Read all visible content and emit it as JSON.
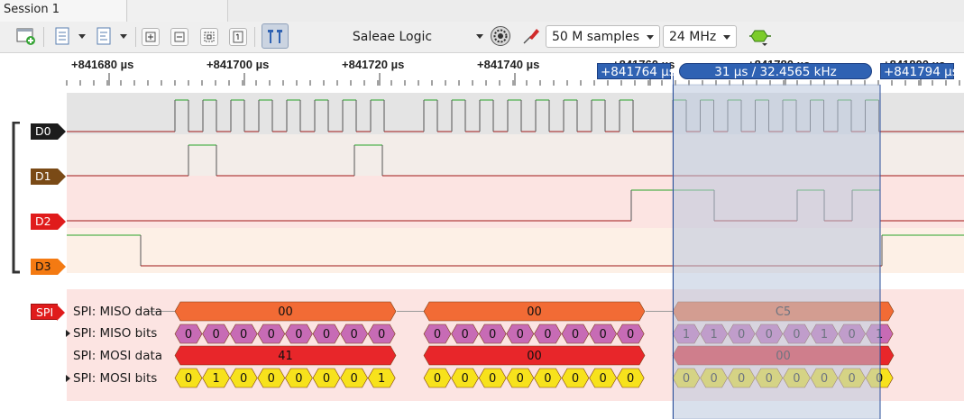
{
  "tabs": {
    "session_label": "Session 1"
  },
  "toolbar": {
    "device": "Saleae Logic",
    "sample_count": "50 M samples",
    "sample_rate": "24 MHz"
  },
  "timeline": {
    "ticks": [
      "+841680 µs",
      "+841700 µs",
      "+841720 µs",
      "+841740 µs",
      "+841760 µs",
      "+841780 µs",
      "+841800 µs"
    ],
    "cursor_left": "+841764 µs",
    "cursor_measure": "31 µs / 32.4565 kHz",
    "cursor_right": "+841794 µs"
  },
  "channels": [
    {
      "label": "D0"
    },
    {
      "label": "D1"
    },
    {
      "label": "D2"
    },
    {
      "label": "D3"
    }
  ],
  "analyzer": {
    "label": "SPI",
    "rows": [
      {
        "label": "SPI: MISO data",
        "has_arrow": false
      },
      {
        "label": "SPI: MISO bits",
        "has_arrow": true
      },
      {
        "label": "SPI: MOSI data",
        "has_arrow": false
      },
      {
        "label": "SPI: MOSI bits",
        "has_arrow": true
      }
    ],
    "miso_data": [
      "00",
      "00",
      "C5"
    ],
    "miso_bits": [
      [
        "0",
        "0",
        "0",
        "0",
        "0",
        "0",
        "0",
        "0"
      ],
      [
        "0",
        "0",
        "0",
        "0",
        "0",
        "0",
        "0",
        "0"
      ],
      [
        "1",
        "1",
        "0",
        "0",
        "0",
        "1",
        "0",
        "1"
      ]
    ],
    "mosi_data": [
      "41",
      "00",
      "00"
    ],
    "mosi_bits": [
      [
        "0",
        "1",
        "0",
        "0",
        "0",
        "0",
        "0",
        "1"
      ],
      [
        "0",
        "0",
        "0",
        "0",
        "0",
        "0",
        "0",
        "0"
      ],
      [
        "0",
        "0",
        "0",
        "0",
        "0",
        "0",
        "0",
        "0"
      ]
    ]
  },
  "colors": {
    "signal_high": "#2aa52a",
    "signal_low": "#a01818",
    "miso_data_fill": "#f26b35",
    "miso_bits_fill": "#c76bb5",
    "mosi_data_fill": "#e8262a",
    "mosi_bits_fill": "#f7e21c",
    "selection": "#b9c6dc",
    "cursor_pill": "#2f62b3"
  }
}
